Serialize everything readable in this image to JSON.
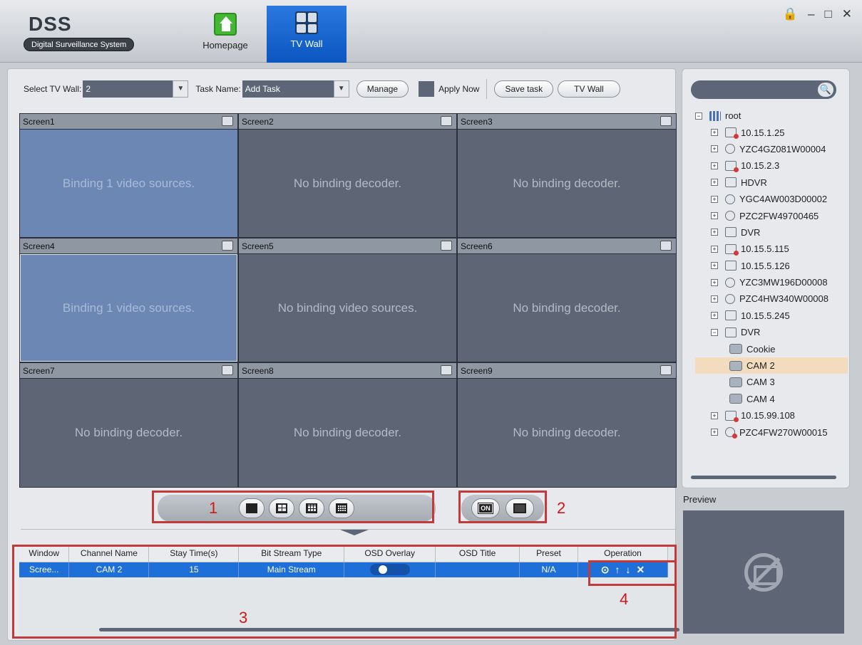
{
  "app": {
    "name": "DSS",
    "subtitle": "Digital Surveillance System"
  },
  "nav": {
    "home_label": "Homepage",
    "tvwall_label": "TV Wall"
  },
  "toolbar": {
    "select_tv_wall_label": "Select TV Wall:",
    "select_tv_wall_value": "2",
    "task_name_label": "Task Name:",
    "task_name_value": "Add Task",
    "manage_label": "Manage",
    "apply_now_label": "Apply Now",
    "save_task_label": "Save task",
    "tv_wall_label": "TV Wall"
  },
  "screens": [
    {
      "name": "Screen1",
      "status": "Binding 1 video sources."
    },
    {
      "name": "Screen2",
      "status": "No binding decoder."
    },
    {
      "name": "Screen3",
      "status": "No binding decoder."
    },
    {
      "name": "Screen4",
      "status": "Binding 1 video sources."
    },
    {
      "name": "Screen5",
      "status": "No binding video sources."
    },
    {
      "name": "Screen6",
      "status": "No binding decoder."
    },
    {
      "name": "Screen7",
      "status": "No binding decoder."
    },
    {
      "name": "Screen8",
      "status": "No binding decoder."
    },
    {
      "name": "Screen9",
      "status": "No binding decoder."
    }
  ],
  "markers": {
    "m1": "1",
    "m2": "2",
    "m3": "3",
    "m4": "4"
  },
  "layout_controls": {
    "on_label": "ON"
  },
  "table": {
    "headers": [
      "Window",
      "Channel Name",
      "Stay Time(s)",
      "Bit Stream Type",
      "OSD Overlay",
      "OSD Title",
      "Preset",
      "Operation"
    ],
    "rows": [
      {
        "window": "Scree...",
        "channel": "CAM 2",
        "stay": "15",
        "stream": "Main Stream",
        "osd_title": "",
        "preset": "N/A"
      }
    ]
  },
  "tree": {
    "nodes": [
      {
        "label": "root",
        "level": 0,
        "expand": "−",
        "icon": "root-icon"
      },
      {
        "label": "10.15.1.25",
        "level": 1,
        "expand": "+",
        "icon": "device-offline-icon"
      },
      {
        "label": "YZC4GZ081W00004",
        "level": 1,
        "expand": "+",
        "icon": "ipc-icon"
      },
      {
        "label": "10.15.2.3",
        "level": 1,
        "expand": "+",
        "icon": "device-offline-icon"
      },
      {
        "label": "HDVR",
        "level": 1,
        "expand": "+",
        "icon": "device-icon"
      },
      {
        "label": "YGC4AW003D00002",
        "level": 1,
        "expand": "+",
        "icon": "ipc-icon"
      },
      {
        "label": "PZC2FW49700465",
        "level": 1,
        "expand": "+",
        "icon": "ipc-icon"
      },
      {
        "label": "DVR",
        "level": 1,
        "expand": "+",
        "icon": "device-icon"
      },
      {
        "label": "10.15.5.115",
        "level": 1,
        "expand": "+",
        "icon": "device-offline-icon"
      },
      {
        "label": "10.15.5.126",
        "level": 1,
        "expand": "+",
        "icon": "device-icon"
      },
      {
        "label": "YZC3MW196D00008",
        "level": 1,
        "expand": "+",
        "icon": "ipc-icon"
      },
      {
        "label": "PZC4HW340W00008",
        "level": 1,
        "expand": "+",
        "icon": "ipc-icon"
      },
      {
        "label": "10.15.5.245",
        "level": 1,
        "expand": "+",
        "icon": "device-icon"
      },
      {
        "label": "DVR",
        "level": 1,
        "expand": "−",
        "icon": "device-icon"
      },
      {
        "label": "Cookie",
        "level": 2,
        "expand": "",
        "icon": "camera-icon"
      },
      {
        "label": "CAM 2",
        "level": 2,
        "expand": "",
        "icon": "camera-icon",
        "selected": true
      },
      {
        "label": "CAM 3",
        "level": 2,
        "expand": "",
        "icon": "camera-icon"
      },
      {
        "label": "CAM 4",
        "level": 2,
        "expand": "",
        "icon": "camera-icon"
      },
      {
        "label": "10.15.99.108",
        "level": 1,
        "expand": "+",
        "icon": "device-offline-icon"
      },
      {
        "label": "PZC4FW270W00015",
        "level": 1,
        "expand": "+",
        "icon": "ipc-offline-icon"
      }
    ]
  },
  "preview": {
    "label": "Preview"
  }
}
